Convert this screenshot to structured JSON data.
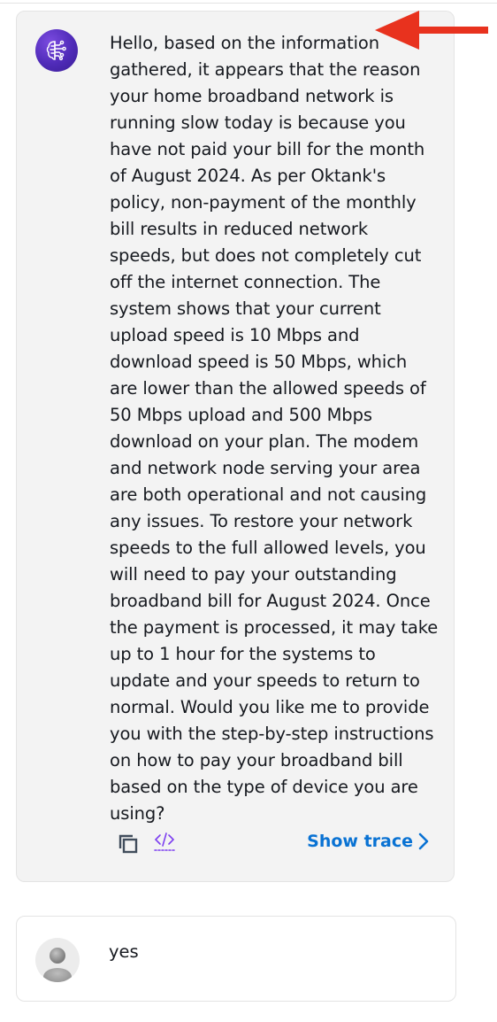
{
  "bot_message": {
    "text": "Hello, based on the information gathered, it appears that the reason your home broadband network is running slow today is because you have not paid your bill for the month of August 2024. As per Oktank's policy, non-payment of the monthly bill results in reduced network speeds, but does not completely cut off the internet connection. The system shows that your current upload speed is 10 Mbps and download speed is 50 Mbps, which are lower than the allowed speeds of 50 Mbps upload and 500 Mbps download on your plan. The modem and network node serving your area are both operational and not causing any issues. To restore your network speeds to the full allowed levels, you will need to pay your outstanding broadband bill for August 2024. Once the payment is processed, it may take up to 1 hour for the systems to update and your speeds to return to normal. Would you like me to provide you with the step-by-step instructions on how to pay your broadband bill based on the type of device you are using?",
    "show_trace_label": "Show trace",
    "avatar_icon": "ai-brain-icon",
    "avatar_color": "#5a30c8"
  },
  "user_message": {
    "text": "yes",
    "avatar_icon": "user-silhouette-icon"
  },
  "colors": {
    "link": "#0972d3",
    "annotation": "#e8321e",
    "bubble_bg": "#f3f3f3"
  }
}
